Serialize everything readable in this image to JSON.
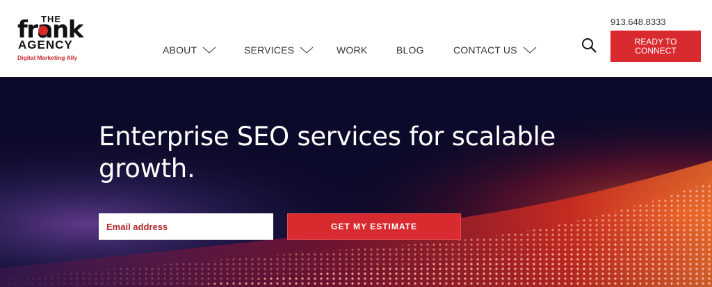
{
  "logo": {
    "the": "THE",
    "frank": "frank",
    "agency": "AGENCY",
    "tagline": "Digital Marketing Ally"
  },
  "nav": {
    "items": [
      {
        "label": "ABOUT",
        "dropdown": true
      },
      {
        "label": "SERVICES",
        "dropdown": true
      },
      {
        "label": "WORK",
        "dropdown": false
      },
      {
        "label": "BLOG",
        "dropdown": false
      },
      {
        "label": "CONTACT US",
        "dropdown": true
      }
    ]
  },
  "header": {
    "phone": "913.648.8333",
    "cta_label": "READY TO CONNECT",
    "search_icon": "search-icon"
  },
  "hero": {
    "headline": "Enterprise SEO services for scalable growth.",
    "email_placeholder": "Email address",
    "submit_label": "GET MY ESTIMATE"
  },
  "colors": {
    "brand_red": "#d92b2f",
    "hero_bg": "#0c0a2a",
    "nav_text": "#333333"
  }
}
